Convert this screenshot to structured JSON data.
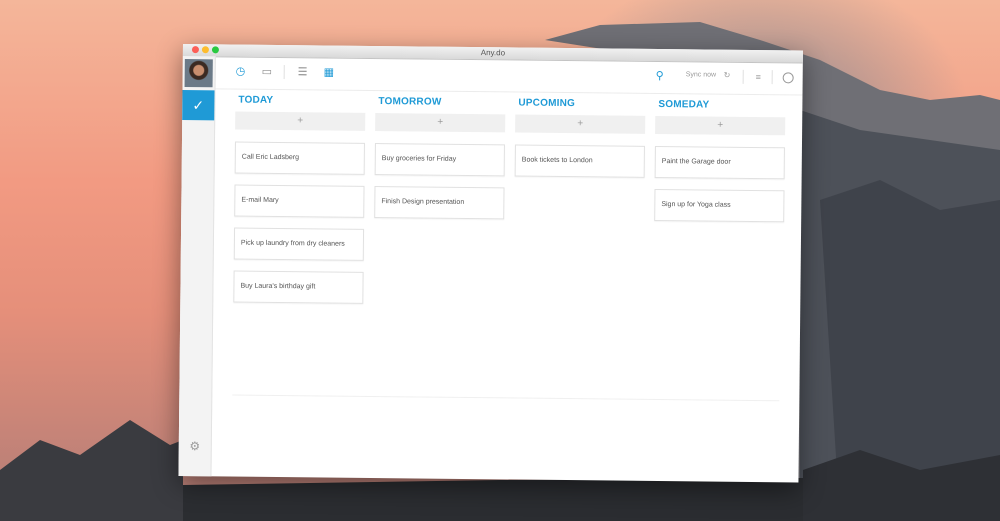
{
  "window": {
    "title": "Any.do"
  },
  "toolbar": {
    "sync_label": "Sync now"
  },
  "columns": [
    {
      "title": "TODAY",
      "tasks": [
        "Call Eric Ladsberg",
        "E-mail Mary",
        "Pick up laundry from dry cleaners",
        "Buy Laura's birthday gift"
      ]
    },
    {
      "title": "TOMORROW",
      "tasks": [
        "Buy groceries for Friday",
        "Finish Design presentation"
      ]
    },
    {
      "title": "UPCOMING",
      "tasks": [
        "Book tickets to London"
      ]
    },
    {
      "title": "SOMEDAY",
      "tasks": [
        "Paint the Garage door",
        "Sign up for Yoga class"
      ]
    }
  ],
  "add_label": "+",
  "colors": {
    "accent": "#1f9ad6"
  },
  "icons": [
    "checkmark-icon",
    "gear-icon",
    "clock-icon",
    "folder-icon",
    "list-view-icon",
    "column-view-icon",
    "search-icon",
    "sync-icon",
    "menu-icon",
    "circle-icon"
  ]
}
